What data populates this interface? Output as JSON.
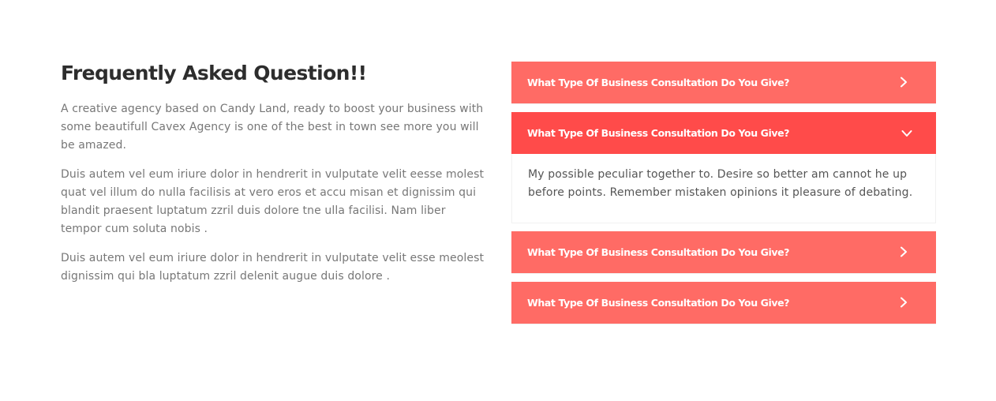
{
  "intro": {
    "title": "Frequently Asked Question!!",
    "paragraphs": [
      "A creative agency based on Candy Land, ready to boost your business with some beautifull Cavex Agency is one of the best in town see more you will be amazed.",
      "Duis autem vel eum iriure dolor in hendrerit in vulputate velit eesse molest quat vel illum do nulla facilisis at vero eros et accu misan et dignissim qui blandit praesent luptatum zzril duis dolore tne ulla facilisi. Nam liber tempor cum soluta nobis .",
      "Duis autem vel eum iriure dolor in hendrerit in vulputate velit esse meolest dignissim qui bla luptatum zzril delenit augue duis dolore ."
    ]
  },
  "faq": {
    "colors": {
      "header": "#ff6b65",
      "header_active": "#ff4b4a",
      "title": "#2d2d2d",
      "body_text": "#777777"
    },
    "items": [
      {
        "question": "What Type Of Business Consultation Do You Give?",
        "expanded": false,
        "icon": "chevron-right-icon"
      },
      {
        "question": "What Type Of Business Consultation Do You Give?",
        "expanded": true,
        "icon": "chevron-down-icon",
        "answer": "My possible peculiar together to. Desire so better am cannot he up before points. Remember mistaken opinions it pleasure of debating."
      },
      {
        "question": "What Type Of Business Consultation Do You Give?",
        "expanded": false,
        "icon": "chevron-right-icon"
      },
      {
        "question": "What Type Of Business Consultation Do You Give?",
        "expanded": false,
        "icon": "chevron-right-icon"
      }
    ]
  }
}
